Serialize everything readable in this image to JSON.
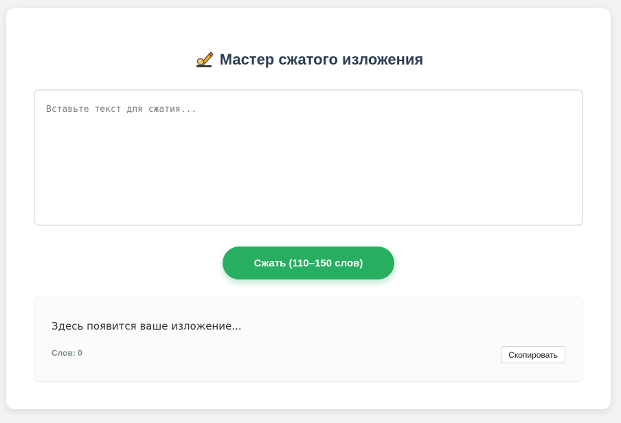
{
  "header": {
    "icon": "writing-hand-icon",
    "title": "Мастер сжатого изложения"
  },
  "input": {
    "placeholder": "Вставьте текст для сжатия...",
    "value": ""
  },
  "compress_button": {
    "label": "Сжать (110–150 слов)",
    "color": "#27ae60"
  },
  "output": {
    "placeholder_text": "Здесь появится ваше изложение...",
    "word_count_label": "Слов: 0",
    "copy_label": "Скопировать"
  }
}
